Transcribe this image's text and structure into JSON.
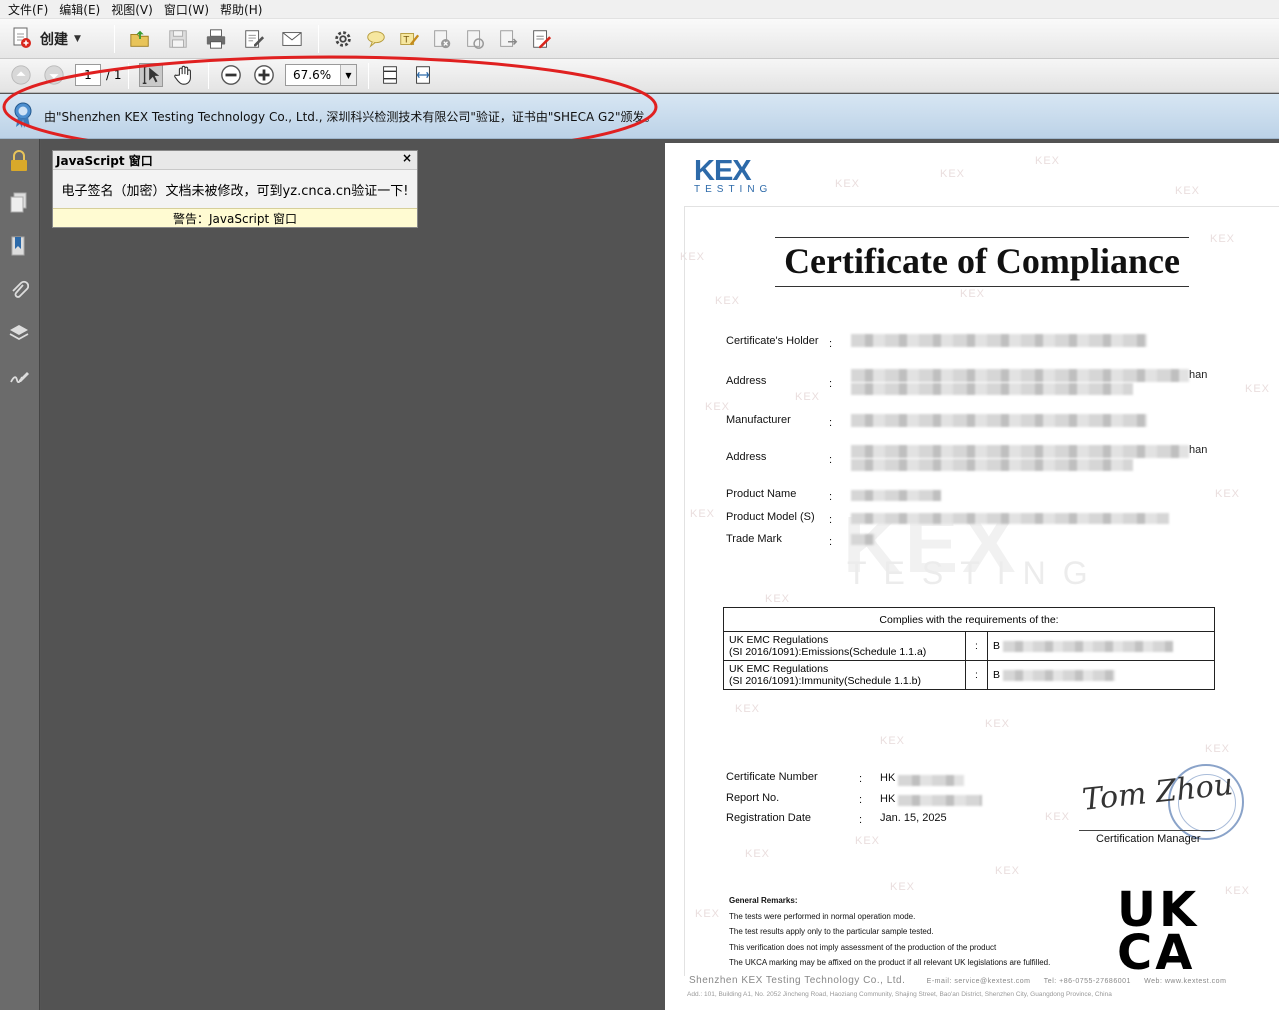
{
  "menu": [
    "文件(F)",
    "编辑(E)",
    "视图(V)",
    "窗口(W)",
    "帮助(H)"
  ],
  "toolbar": {
    "create_label": "创建",
    "page_current": "1",
    "page_total": "/ 1",
    "zoom": "67.6%"
  },
  "signature_bar": {
    "text": "由\"Shenzhen KEX Testing Technology Co., Ltd., 深圳科兴检测技术有限公司\"验证，证书由\"SHECA G2\"颁发。"
  },
  "js_dialog": {
    "title": "JavaScript 窗口",
    "close": "×",
    "message": "电子签名（加密）文档未被修改，可到yz.cnca.cn验证一下!",
    "warning": "警告：JavaScript 窗口"
  },
  "certificate": {
    "logo_main": "KEX",
    "logo_sub": "TESTING",
    "watermark": "KEX",
    "watermark_sub": "TESTING",
    "title": "Certificate of Compliance",
    "fields": {
      "holder": "Certificate's Holder",
      "address1": "Address",
      "manufacturer": "Manufacturer",
      "address2": "Address",
      "product_name": "Product Name",
      "product_model": "Product Model (S)",
      "trade_mark": "Trade Mark",
      "colon": ":",
      "addr_suffix": "han"
    },
    "requirements": {
      "header": "Complies with the requirements of the:",
      "rows": [
        {
          "line1": "UK EMC Regulations",
          "line2": "(SI 2016/1091):Emissions(Schedule 1.1.a)",
          "sep": ":",
          "value_prefix": "B"
        },
        {
          "line1": "UK EMC Regulations",
          "line2": "(SI 2016/1091):Immunity(Schedule 1.1.b)",
          "sep": ":",
          "value_prefix": "B"
        }
      ]
    },
    "cert_number_label": "Certificate Number",
    "cert_number_prefix": "HK",
    "report_label": "Report No.",
    "report_prefix": "HK",
    "reg_date_label": "Registration Date",
    "reg_date": "Jan. 15, 2025",
    "signature": "Tom Zhou",
    "signer_title": "Certification Manager",
    "remarks": {
      "heading": "General Remarks:",
      "items": [
        "The tests were performed in normal operation mode.",
        "The test results apply only to the particular sample tested.",
        "This verification does not imply assessment of the production of the product",
        "The UKCA marking may be affixed on the product if all relevant UK legislations are fulfilled."
      ]
    },
    "ukca_top": "UK",
    "ukca_bottom": "CA",
    "footer_company": "Shenzhen KEX Testing Technology Co., Ltd.",
    "footer_email": "E-mail: service@kextest.com",
    "footer_tel": "Tel: +86-0755-27686001",
    "footer_web": "Web: www.kextest.com",
    "footer_address": "Add.: 101, Building A1, No. 2052 Jincheng Road, Haoziang Community, Shajing Street, Bao'an District, Shenzhen City, Guangdong Province, China"
  },
  "colors": {
    "kex_blue": "#2d6aa9",
    "annotation_red": "#e02020",
    "sigbar_blue": "#c6d9ec"
  }
}
